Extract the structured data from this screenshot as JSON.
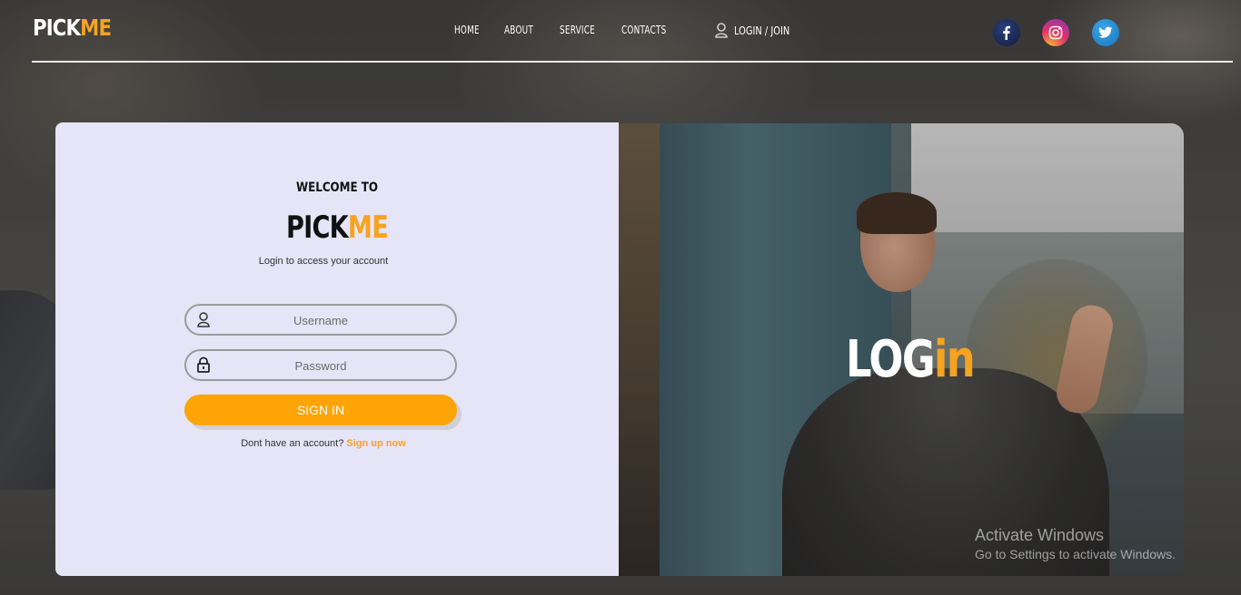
{
  "header": {
    "logo_part1": "PICK",
    "logo_part2": "ME",
    "nav": [
      "HOME",
      "ABOUT",
      "SERVICE",
      "CONTACTS"
    ],
    "login_join": "LOGIN / JOIN"
  },
  "social": [
    {
      "name": "facebook",
      "glyph": "f"
    },
    {
      "name": "instagram",
      "glyph": "◎"
    },
    {
      "name": "twitter",
      "glyph": "🐦"
    }
  ],
  "login_card": {
    "welcome": "WELCOME TO",
    "brand_part1": "PICK",
    "brand_part2": "ME",
    "subtitle": "Login to access your account",
    "username_placeholder": "Username",
    "password_placeholder": "Password",
    "signin_label": "SIGN IN",
    "no_account_text": "Dont have an account?",
    "signup_link": "Sign up now"
  },
  "hero": {
    "title_part1": "LOG",
    "title_part2": "in"
  },
  "watermark": {
    "line1": "Activate Windows",
    "line2": "Go to Settings to activate Windows."
  },
  "colors": {
    "accent": "#f6a320",
    "button": "#ffa406",
    "card_bg": "#e5e5f7"
  }
}
